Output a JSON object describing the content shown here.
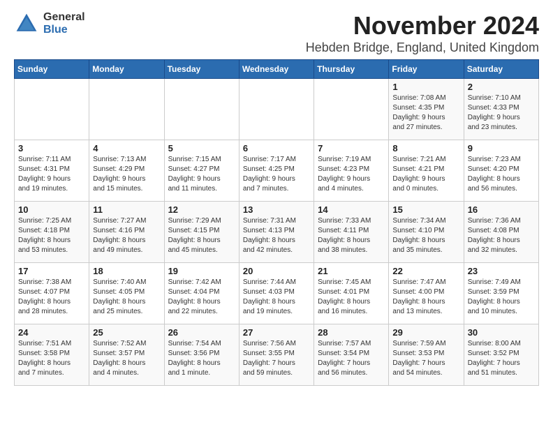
{
  "header": {
    "logo_general": "General",
    "logo_blue": "Blue",
    "month_title": "November 2024",
    "location": "Hebden Bridge, England, United Kingdom"
  },
  "weekdays": [
    "Sunday",
    "Monday",
    "Tuesday",
    "Wednesday",
    "Thursday",
    "Friday",
    "Saturday"
  ],
  "weeks": [
    [
      {
        "day": "",
        "content": ""
      },
      {
        "day": "",
        "content": ""
      },
      {
        "day": "",
        "content": ""
      },
      {
        "day": "",
        "content": ""
      },
      {
        "day": "",
        "content": ""
      },
      {
        "day": "1",
        "content": "Sunrise: 7:08 AM\nSunset: 4:35 PM\nDaylight: 9 hours\nand 27 minutes."
      },
      {
        "day": "2",
        "content": "Sunrise: 7:10 AM\nSunset: 4:33 PM\nDaylight: 9 hours\nand 23 minutes."
      }
    ],
    [
      {
        "day": "3",
        "content": "Sunrise: 7:11 AM\nSunset: 4:31 PM\nDaylight: 9 hours\nand 19 minutes."
      },
      {
        "day": "4",
        "content": "Sunrise: 7:13 AM\nSunset: 4:29 PM\nDaylight: 9 hours\nand 15 minutes."
      },
      {
        "day": "5",
        "content": "Sunrise: 7:15 AM\nSunset: 4:27 PM\nDaylight: 9 hours\nand 11 minutes."
      },
      {
        "day": "6",
        "content": "Sunrise: 7:17 AM\nSunset: 4:25 PM\nDaylight: 9 hours\nand 7 minutes."
      },
      {
        "day": "7",
        "content": "Sunrise: 7:19 AM\nSunset: 4:23 PM\nDaylight: 9 hours\nand 4 minutes."
      },
      {
        "day": "8",
        "content": "Sunrise: 7:21 AM\nSunset: 4:21 PM\nDaylight: 9 hours\nand 0 minutes."
      },
      {
        "day": "9",
        "content": "Sunrise: 7:23 AM\nSunset: 4:20 PM\nDaylight: 8 hours\nand 56 minutes."
      }
    ],
    [
      {
        "day": "10",
        "content": "Sunrise: 7:25 AM\nSunset: 4:18 PM\nDaylight: 8 hours\nand 53 minutes."
      },
      {
        "day": "11",
        "content": "Sunrise: 7:27 AM\nSunset: 4:16 PM\nDaylight: 8 hours\nand 49 minutes."
      },
      {
        "day": "12",
        "content": "Sunrise: 7:29 AM\nSunset: 4:15 PM\nDaylight: 8 hours\nand 45 minutes."
      },
      {
        "day": "13",
        "content": "Sunrise: 7:31 AM\nSunset: 4:13 PM\nDaylight: 8 hours\nand 42 minutes."
      },
      {
        "day": "14",
        "content": "Sunrise: 7:33 AM\nSunset: 4:11 PM\nDaylight: 8 hours\nand 38 minutes."
      },
      {
        "day": "15",
        "content": "Sunrise: 7:34 AM\nSunset: 4:10 PM\nDaylight: 8 hours\nand 35 minutes."
      },
      {
        "day": "16",
        "content": "Sunrise: 7:36 AM\nSunset: 4:08 PM\nDaylight: 8 hours\nand 32 minutes."
      }
    ],
    [
      {
        "day": "17",
        "content": "Sunrise: 7:38 AM\nSunset: 4:07 PM\nDaylight: 8 hours\nand 28 minutes."
      },
      {
        "day": "18",
        "content": "Sunrise: 7:40 AM\nSunset: 4:05 PM\nDaylight: 8 hours\nand 25 minutes."
      },
      {
        "day": "19",
        "content": "Sunrise: 7:42 AM\nSunset: 4:04 PM\nDaylight: 8 hours\nand 22 minutes."
      },
      {
        "day": "20",
        "content": "Sunrise: 7:44 AM\nSunset: 4:03 PM\nDaylight: 8 hours\nand 19 minutes."
      },
      {
        "day": "21",
        "content": "Sunrise: 7:45 AM\nSunset: 4:01 PM\nDaylight: 8 hours\nand 16 minutes."
      },
      {
        "day": "22",
        "content": "Sunrise: 7:47 AM\nSunset: 4:00 PM\nDaylight: 8 hours\nand 13 minutes."
      },
      {
        "day": "23",
        "content": "Sunrise: 7:49 AM\nSunset: 3:59 PM\nDaylight: 8 hours\nand 10 minutes."
      }
    ],
    [
      {
        "day": "24",
        "content": "Sunrise: 7:51 AM\nSunset: 3:58 PM\nDaylight: 8 hours\nand 7 minutes."
      },
      {
        "day": "25",
        "content": "Sunrise: 7:52 AM\nSunset: 3:57 PM\nDaylight: 8 hours\nand 4 minutes."
      },
      {
        "day": "26",
        "content": "Sunrise: 7:54 AM\nSunset: 3:56 PM\nDaylight: 8 hours\nand 1 minute."
      },
      {
        "day": "27",
        "content": "Sunrise: 7:56 AM\nSunset: 3:55 PM\nDaylight: 7 hours\nand 59 minutes."
      },
      {
        "day": "28",
        "content": "Sunrise: 7:57 AM\nSunset: 3:54 PM\nDaylight: 7 hours\nand 56 minutes."
      },
      {
        "day": "29",
        "content": "Sunrise: 7:59 AM\nSunset: 3:53 PM\nDaylight: 7 hours\nand 54 minutes."
      },
      {
        "day": "30",
        "content": "Sunrise: 8:00 AM\nSunset: 3:52 PM\nDaylight: 7 hours\nand 51 minutes."
      }
    ]
  ]
}
